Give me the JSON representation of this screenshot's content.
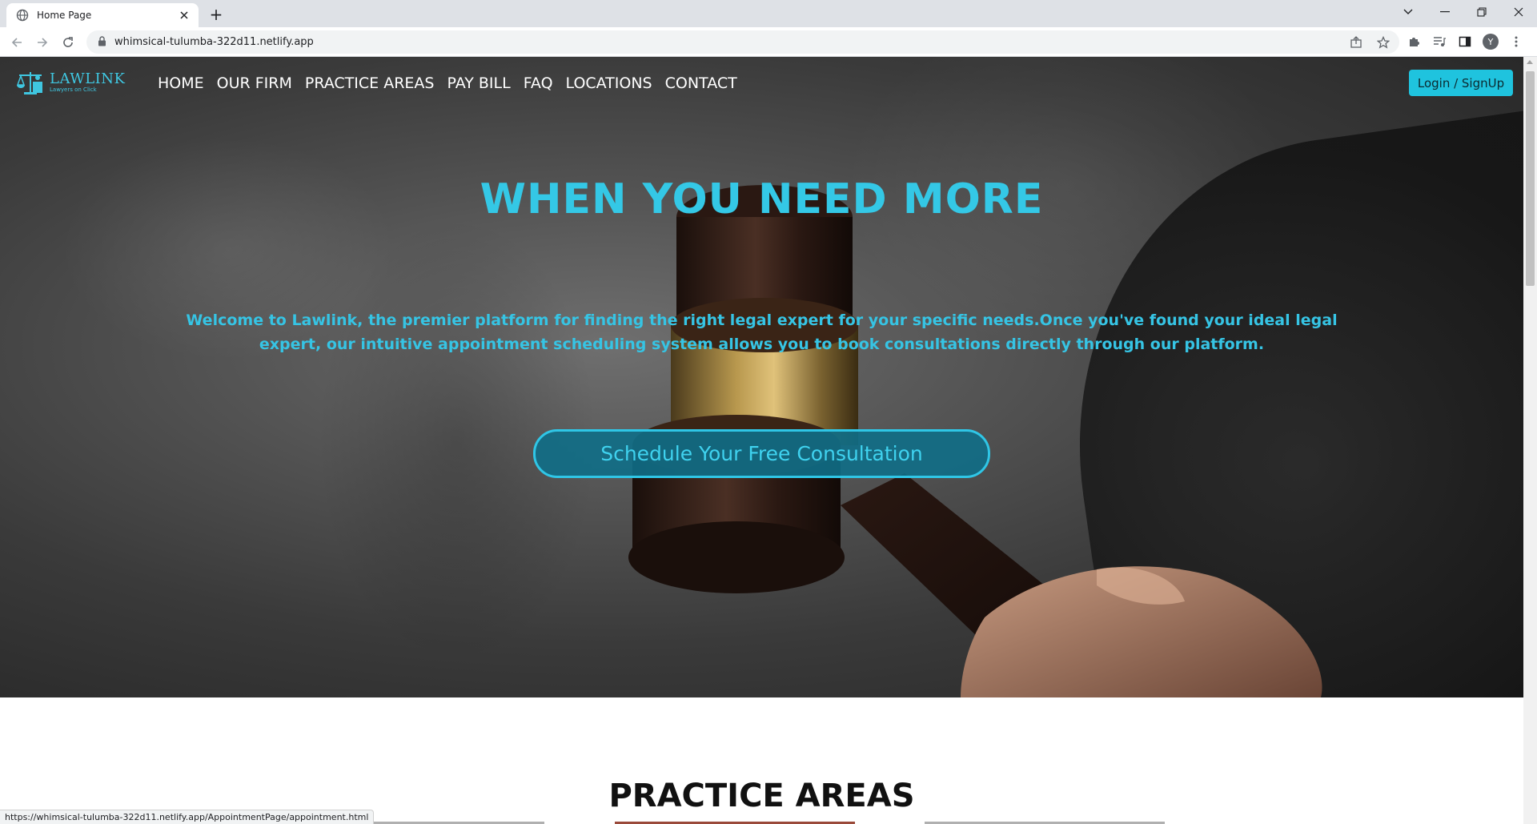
{
  "browser": {
    "tab_title": "Home Page",
    "new_tab_symbol": "+",
    "url": "whimsical-tulumba-322d11.netlify.app",
    "profile_initial": "Y",
    "status_url": "https://whimsical-tulumba-322d11.netlify.app/AppointmentPage/appointment.html"
  },
  "site": {
    "logo": {
      "name": "LAWLINK",
      "tagline": "Lawyers on Click"
    },
    "nav": [
      "HOME",
      "OUR FIRM",
      "PRACTICE AREAS",
      "PAY BILL",
      "FAQ",
      "LOCATIONS",
      "CONTACT"
    ],
    "login_label": "Login / SignUp",
    "hero": {
      "title": "WHEN YOU NEED MORE",
      "description": "Welcome to Lawlink, the premier platform for finding the right legal expert for your specific needs.Once you've found your ideal legal expert, our intuitive appointment scheduling system allows you to book consultations directly through our platform.",
      "cta_label": "Schedule Your Free Consultation"
    },
    "practice_title": "PRACTICE AREAS"
  },
  "colors": {
    "accent": "#34c8e6",
    "login_bg": "#1fc3de",
    "cta_bg": "#0f6e87"
  }
}
